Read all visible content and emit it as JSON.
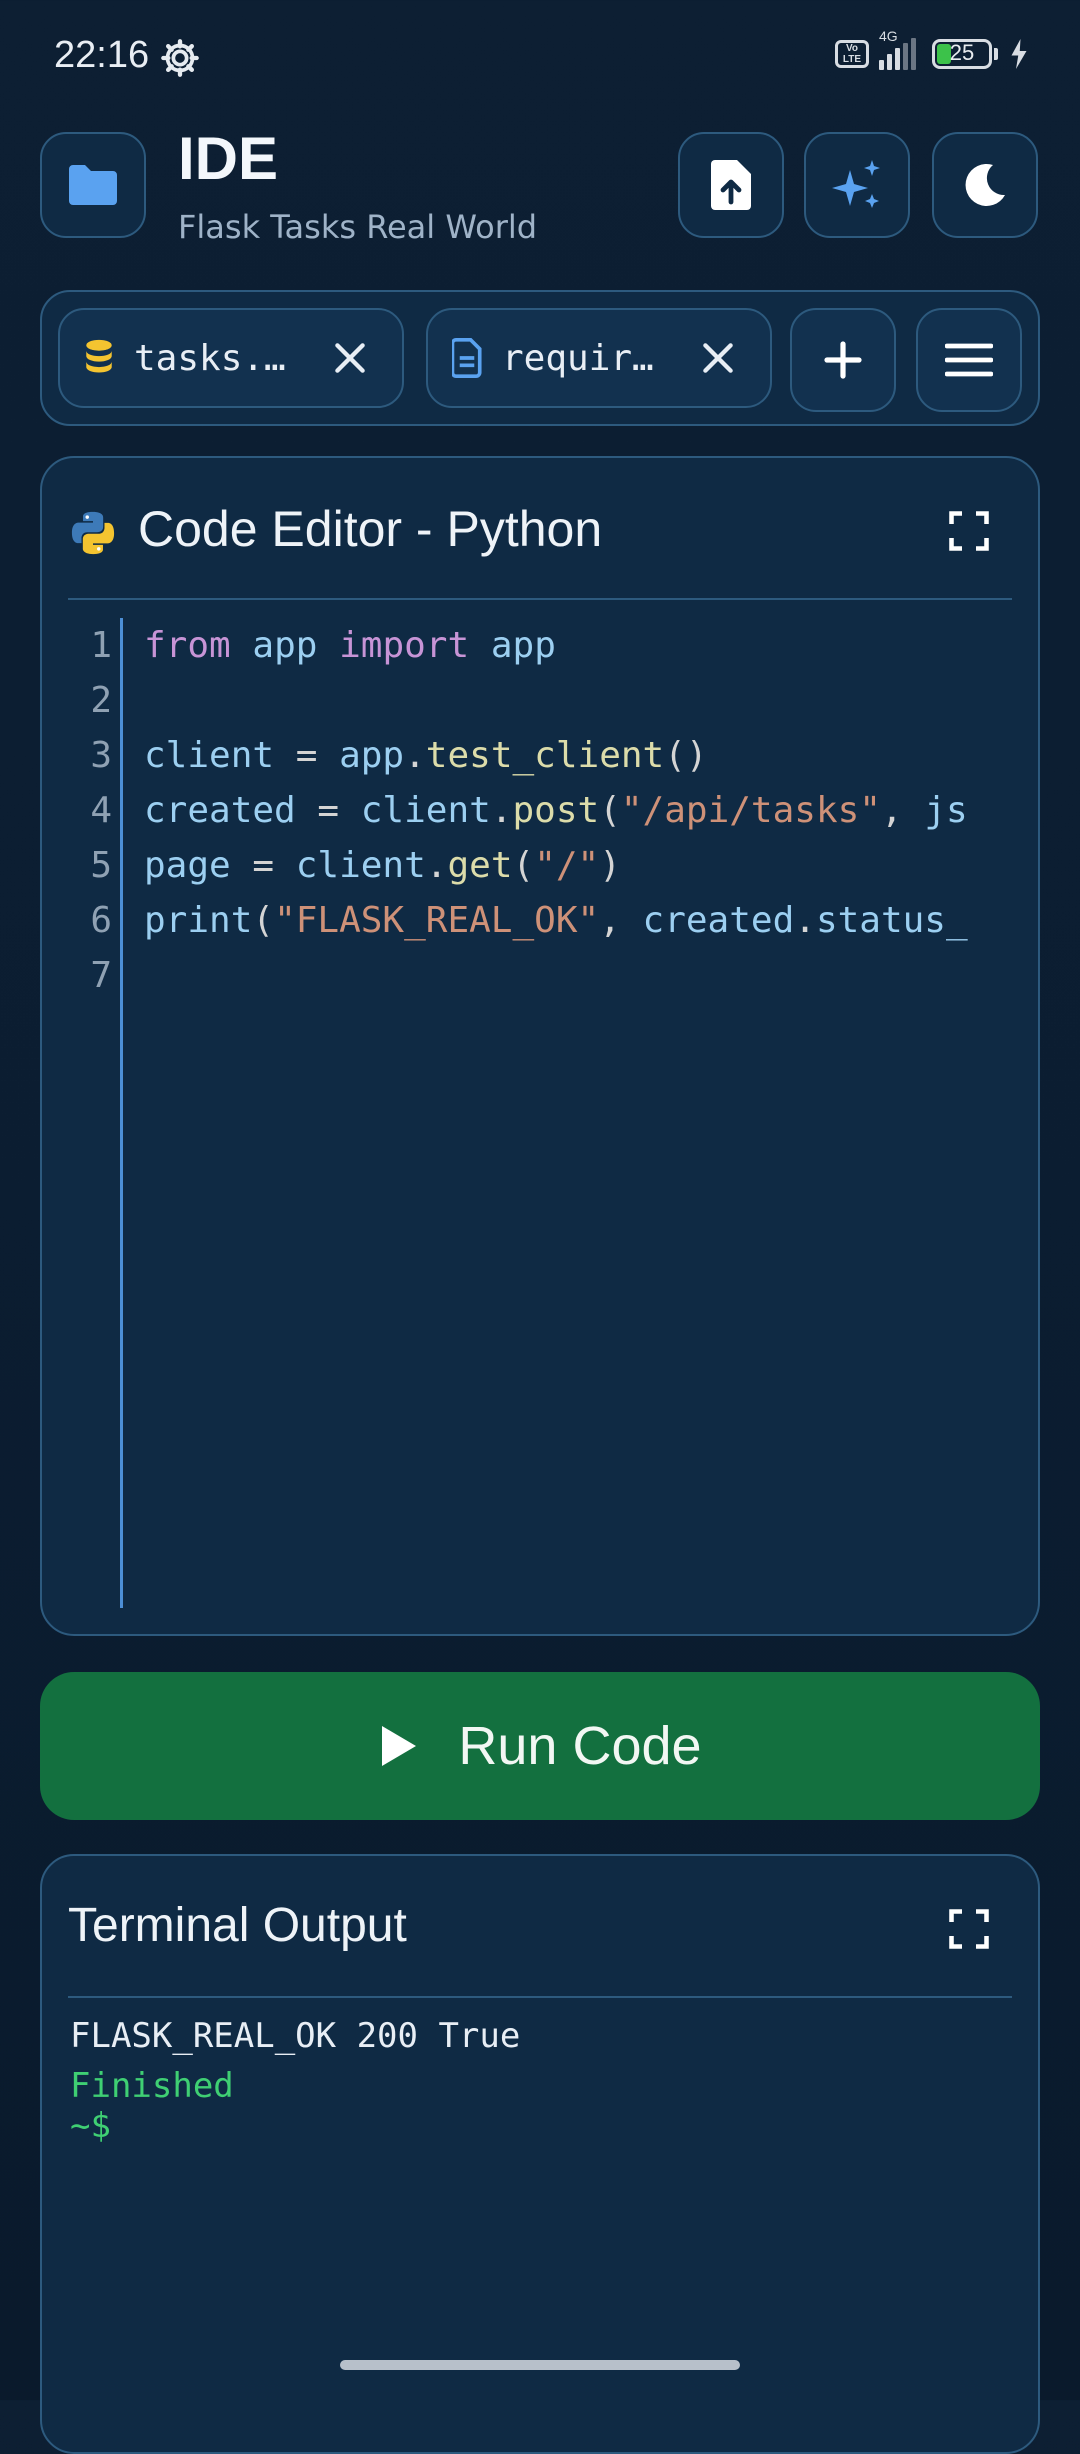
{
  "status_bar": {
    "time": "22:16",
    "network": "4G",
    "battery": "25"
  },
  "header": {
    "title": "IDE",
    "subtitle": "Flask Tasks Real World"
  },
  "tabs": [
    {
      "label": "tasks.…",
      "icon": "database-icon"
    },
    {
      "label": "requir…",
      "icon": "document-icon"
    }
  ],
  "editor": {
    "title": "Code Editor - Python",
    "line_numbers": [
      "1",
      "2",
      "3",
      "4",
      "5",
      "6",
      "7"
    ],
    "lines": [
      [
        {
          "t": "from",
          "c": "kw"
        },
        {
          "t": " ",
          "c": "pn"
        },
        {
          "t": "app",
          "c": "id"
        },
        {
          "t": " ",
          "c": "pn"
        },
        {
          "t": "import",
          "c": "kw"
        },
        {
          "t": " ",
          "c": "pn"
        },
        {
          "t": "app",
          "c": "id"
        }
      ],
      [],
      [
        {
          "t": "client",
          "c": "id"
        },
        {
          "t": " = ",
          "c": "pn"
        },
        {
          "t": "app",
          "c": "id"
        },
        {
          "t": ".",
          "c": "pn"
        },
        {
          "t": "test_client",
          "c": "fn"
        },
        {
          "t": "()",
          "c": "pn"
        }
      ],
      [
        {
          "t": "created",
          "c": "id"
        },
        {
          "t": " = ",
          "c": "pn"
        },
        {
          "t": "client",
          "c": "id"
        },
        {
          "t": ".",
          "c": "pn"
        },
        {
          "t": "post",
          "c": "fn"
        },
        {
          "t": "(",
          "c": "pn"
        },
        {
          "t": "\"/api/tasks\"",
          "c": "str"
        },
        {
          "t": ", ",
          "c": "pn"
        },
        {
          "t": "js",
          "c": "id"
        }
      ],
      [
        {
          "t": "page",
          "c": "id"
        },
        {
          "t": " = ",
          "c": "pn"
        },
        {
          "t": "client",
          "c": "id"
        },
        {
          "t": ".",
          "c": "pn"
        },
        {
          "t": "get",
          "c": "fn"
        },
        {
          "t": "(",
          "c": "pn"
        },
        {
          "t": "\"/\"",
          "c": "str"
        },
        {
          "t": ")",
          "c": "pn"
        }
      ],
      [
        {
          "t": "print",
          "c": "id"
        },
        {
          "t": "(",
          "c": "pn"
        },
        {
          "t": "\"FLASK_REAL_OK\"",
          "c": "str"
        },
        {
          "t": ", ",
          "c": "pn"
        },
        {
          "t": "created",
          "c": "id"
        },
        {
          "t": ".",
          "c": "pn"
        },
        {
          "t": "status_",
          "c": "id"
        }
      ],
      []
    ]
  },
  "run_button": {
    "label": "Run Code"
  },
  "terminal": {
    "title": "Terminal Output",
    "output": "FLASK_REAL_OK 200 True",
    "status": "Finished",
    "prompt": "~$"
  },
  "colors": {
    "accent": "#4d8fd6",
    "run_button": "#13703f",
    "success_text": "#3fcf73",
    "panel_border": "#2d5a7e"
  }
}
